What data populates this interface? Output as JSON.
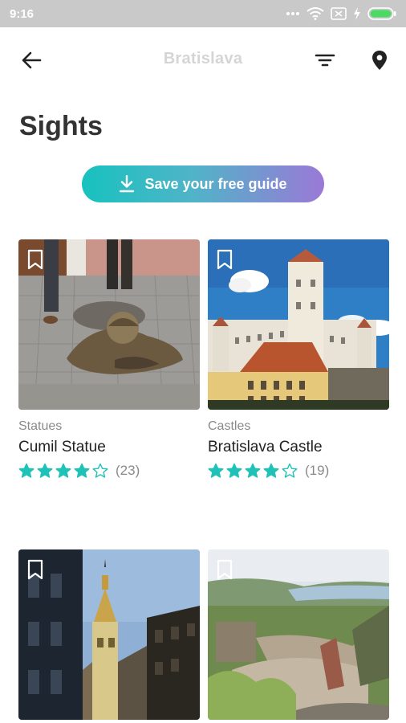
{
  "status_bar": {
    "time": "9:16",
    "icons": [
      "more-dots-icon",
      "wifi-icon",
      "sim-off-icon",
      "charging-icon",
      "battery-icon"
    ]
  },
  "app_bar": {
    "title": "Bratislava",
    "icons": [
      "back-arrow-icon",
      "filter-icon",
      "location-pin-icon"
    ]
  },
  "page": {
    "title": "Sights"
  },
  "save_guide": {
    "label": "Save your free guide",
    "icon": "download-icon",
    "gradient": [
      "#17c2be",
      "#9b79d6"
    ]
  },
  "colors": {
    "accent": "#1fc2b6",
    "star": "#1fc2b6"
  },
  "cards": [
    {
      "category": "Statues",
      "name": "Cumil Statue",
      "rating": 4,
      "max_rating": 5,
      "reviews": "(23)"
    },
    {
      "category": "Castles",
      "name": "Bratislava Castle",
      "rating": 4,
      "max_rating": 5,
      "reviews": "(19)"
    },
    {
      "category": "",
      "name": "",
      "rating": null,
      "max_rating": 5,
      "reviews": ""
    },
    {
      "category": "",
      "name": "",
      "rating": null,
      "max_rating": 5,
      "reviews": ""
    }
  ]
}
